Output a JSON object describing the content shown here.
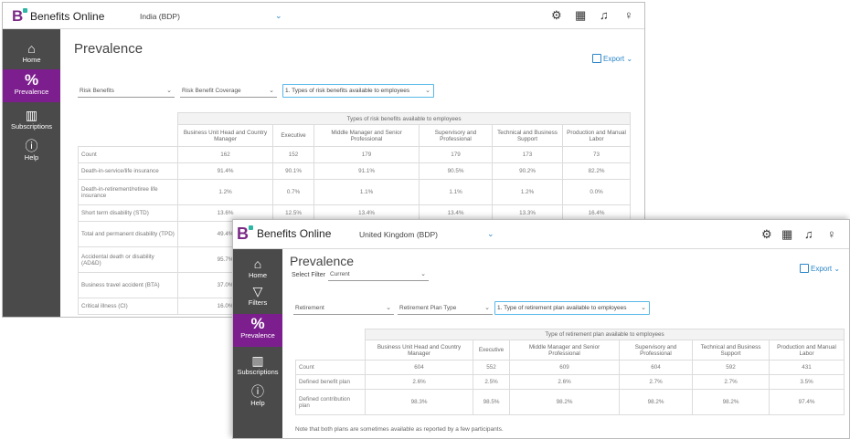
{
  "win1": {
    "app_name": "Benefits Online",
    "logo_letter": "B",
    "company": "India (BDP)",
    "nav": [
      {
        "label": "Home",
        "icon": "⌂"
      },
      {
        "label": "Prevalence",
        "icon": "%"
      },
      {
        "label": "Subscriptions",
        "icon": "▥"
      },
      {
        "label": "Help",
        "icon": "ⓘ"
      }
    ],
    "page_title": "Prevalence",
    "export_label": "Export",
    "filters": [
      "Risk Benefits",
      "Risk Benefit Coverage",
      "1. Types of risk benefits available to employees"
    ],
    "table": {
      "band": "Types of risk benefits available to employees",
      "columns": [
        "Business Unit Head and Country Manager",
        "Executive",
        "Middle Manager and Senior Professional",
        "Supervisory and Professional",
        "Technical and Business Support",
        "Production and Manual Labor"
      ],
      "rows": [
        {
          "label": "Count",
          "values": [
            "162",
            "152",
            "179",
            "179",
            "173",
            "73"
          ]
        },
        {
          "label": "Death-in-service/life insurance",
          "values": [
            "91.4%",
            "90.1%",
            "91.1%",
            "90.5%",
            "90.2%",
            "82.2%"
          ]
        },
        {
          "label": "Death-in-retirement/retiree life insurance",
          "values": [
            "1.2%",
            "0.7%",
            "1.1%",
            "1.1%",
            "1.2%",
            "0.0%"
          ]
        },
        {
          "label": "Short term disability (STD)",
          "values": [
            "13.6%",
            "12.5%",
            "13.4%",
            "13.4%",
            "13.3%",
            "16.4%"
          ]
        },
        {
          "label": "Total and permanent disability (TPD)",
          "values": [
            "49.4%",
            "",
            "",
            "",
            "",
            ""
          ]
        },
        {
          "label": "Accidental death or disability (AD&D)",
          "values": [
            "95.7%",
            "",
            "",
            "",
            "",
            ""
          ]
        },
        {
          "label": "Business travel accident (BTA)",
          "values": [
            "37.0%",
            "",
            "",
            "",
            "",
            ""
          ]
        },
        {
          "label": "Critical illness (CI)",
          "values": [
            "16.0%",
            "",
            "",
            "",
            "",
            ""
          ]
        }
      ]
    }
  },
  "win2": {
    "app_name": "Benefits Online",
    "logo_letter": "B",
    "company": "United Kingdom (BDP)",
    "nav": [
      {
        "label": "Home",
        "icon": "⌂"
      },
      {
        "label": "Filters",
        "icon": "▽"
      },
      {
        "label": "Prevalence",
        "icon": "%"
      },
      {
        "label": "Subscriptions",
        "icon": "▥"
      },
      {
        "label": "Help",
        "icon": "ⓘ"
      }
    ],
    "page_title": "Prevalence",
    "select_filter_label": "Select Filter",
    "select_filter_value": "Current",
    "export_label": "Export",
    "filters": [
      "Retirement",
      "Retirement Plan Type",
      "1. Type of retirement plan available to employees"
    ],
    "table": {
      "band": "Type of retirement plan available to employees",
      "columns": [
        "Business Unit Head and Country Manager",
        "Executive",
        "Middle Manager and Senior Professional",
        "Supervisory and Professional",
        "Technical and Business Support",
        "Production and Manual Labor"
      ],
      "rows": [
        {
          "label": "Count",
          "values": [
            "604",
            "552",
            "609",
            "604",
            "592",
            "431"
          ]
        },
        {
          "label": "Defined benefit plan",
          "values": [
            "2.6%",
            "2.5%",
            "2.6%",
            "2.7%",
            "2.7%",
            "3.5%"
          ]
        },
        {
          "label": "Defined contribution plan",
          "values": [
            "98.3%",
            "98.5%",
            "98.2%",
            "98.2%",
            "98.2%",
            "97.4%"
          ]
        }
      ]
    },
    "note": "Note that both plans are sometimes available as reported by a few participants."
  },
  "colors": {
    "accent": "#7d1e8f",
    "sidebar": "#4a4a4a",
    "link": "#2a86c8",
    "logo_dot": "#2fb5a4"
  }
}
